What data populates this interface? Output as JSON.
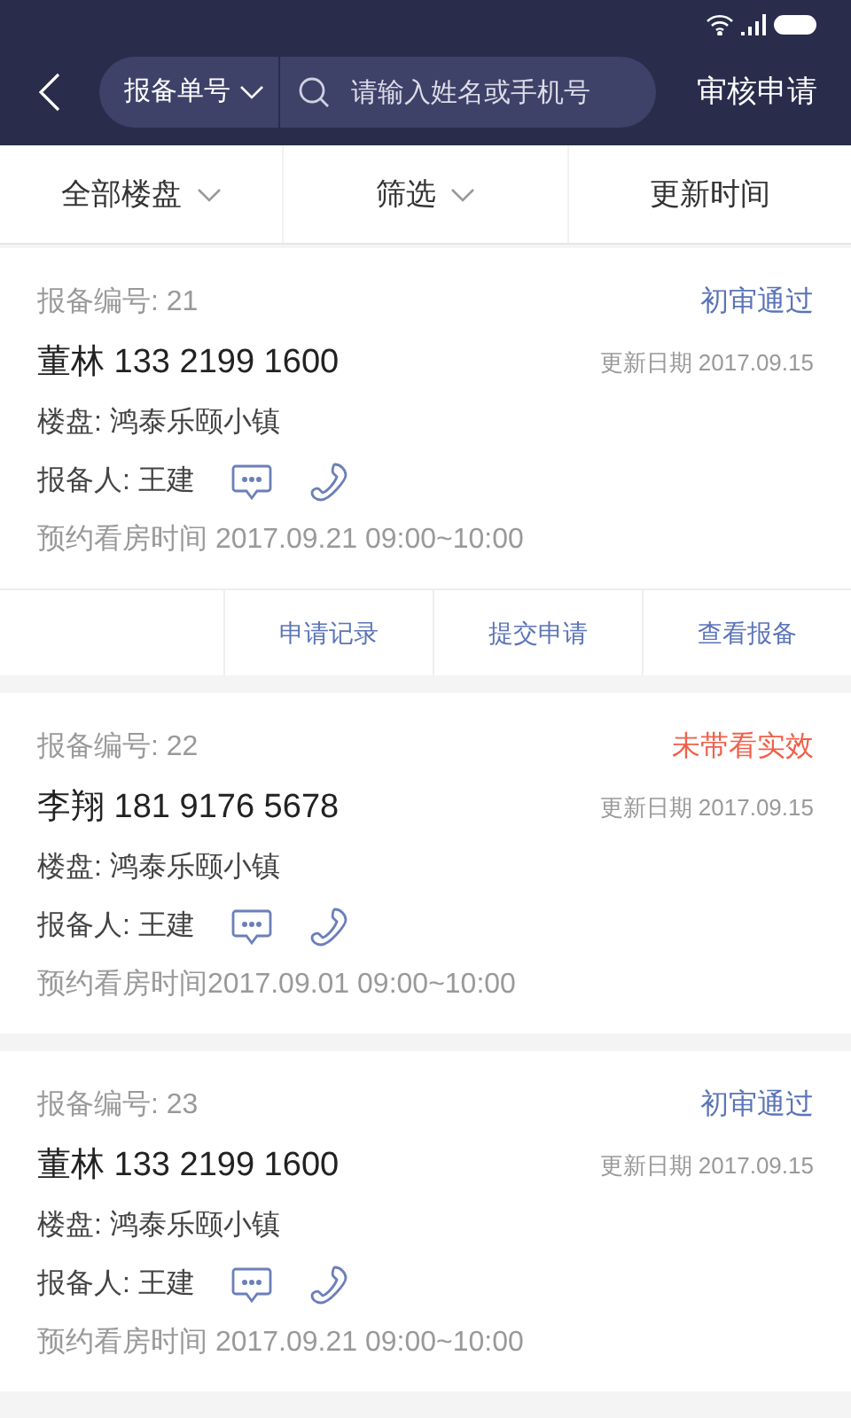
{
  "header": {
    "search_type": "报备单号",
    "search": {
      "placeholder": "请输入姓名或手机号"
    },
    "action": "审核申请"
  },
  "filters": [
    {
      "label": "全部楼盘",
      "dropdown": true
    },
    {
      "label": "筛选",
      "dropdown": true
    },
    {
      "label": "更新时间",
      "dropdown": false
    }
  ],
  "records": [
    {
      "number": "报备编号: 21",
      "status": "初审通过",
      "color": "#5b74b8",
      "client": "董林 133 2199 1600",
      "updated": "更新日期 2017.09.15",
      "project": "楼盘: 鸿泰乐颐小镇",
      "reporter": "报备人: 王建",
      "visit": "预约看房时间 2017.09.21 09:00~10:00",
      "actions": [
        "申请记录",
        "提交申请",
        "查看报备"
      ]
    },
    {
      "number": "报备编号: 22",
      "status": "未带看实效",
      "color": "#f0604a",
      "client": "李翔 181 9176 5678",
      "updated": "更新日期 2017.09.15",
      "project": "楼盘: 鸿泰乐颐小镇",
      "reporter": "报备人: 王建",
      "visit": "预约看房时间2017.09.01 09:00~10:00"
    },
    {
      "number": "报备编号: 23",
      "status": "初审通过",
      "color": "#5b74b8",
      "client": "董林 133 2199 1600",
      "updated": "更新日期 2017.09.15",
      "project": "楼盘: 鸿泰乐颐小镇",
      "reporter": "报备人: 王建",
      "visit": "预约看房时间 2017.09.21 09:00~10:00"
    }
  ]
}
